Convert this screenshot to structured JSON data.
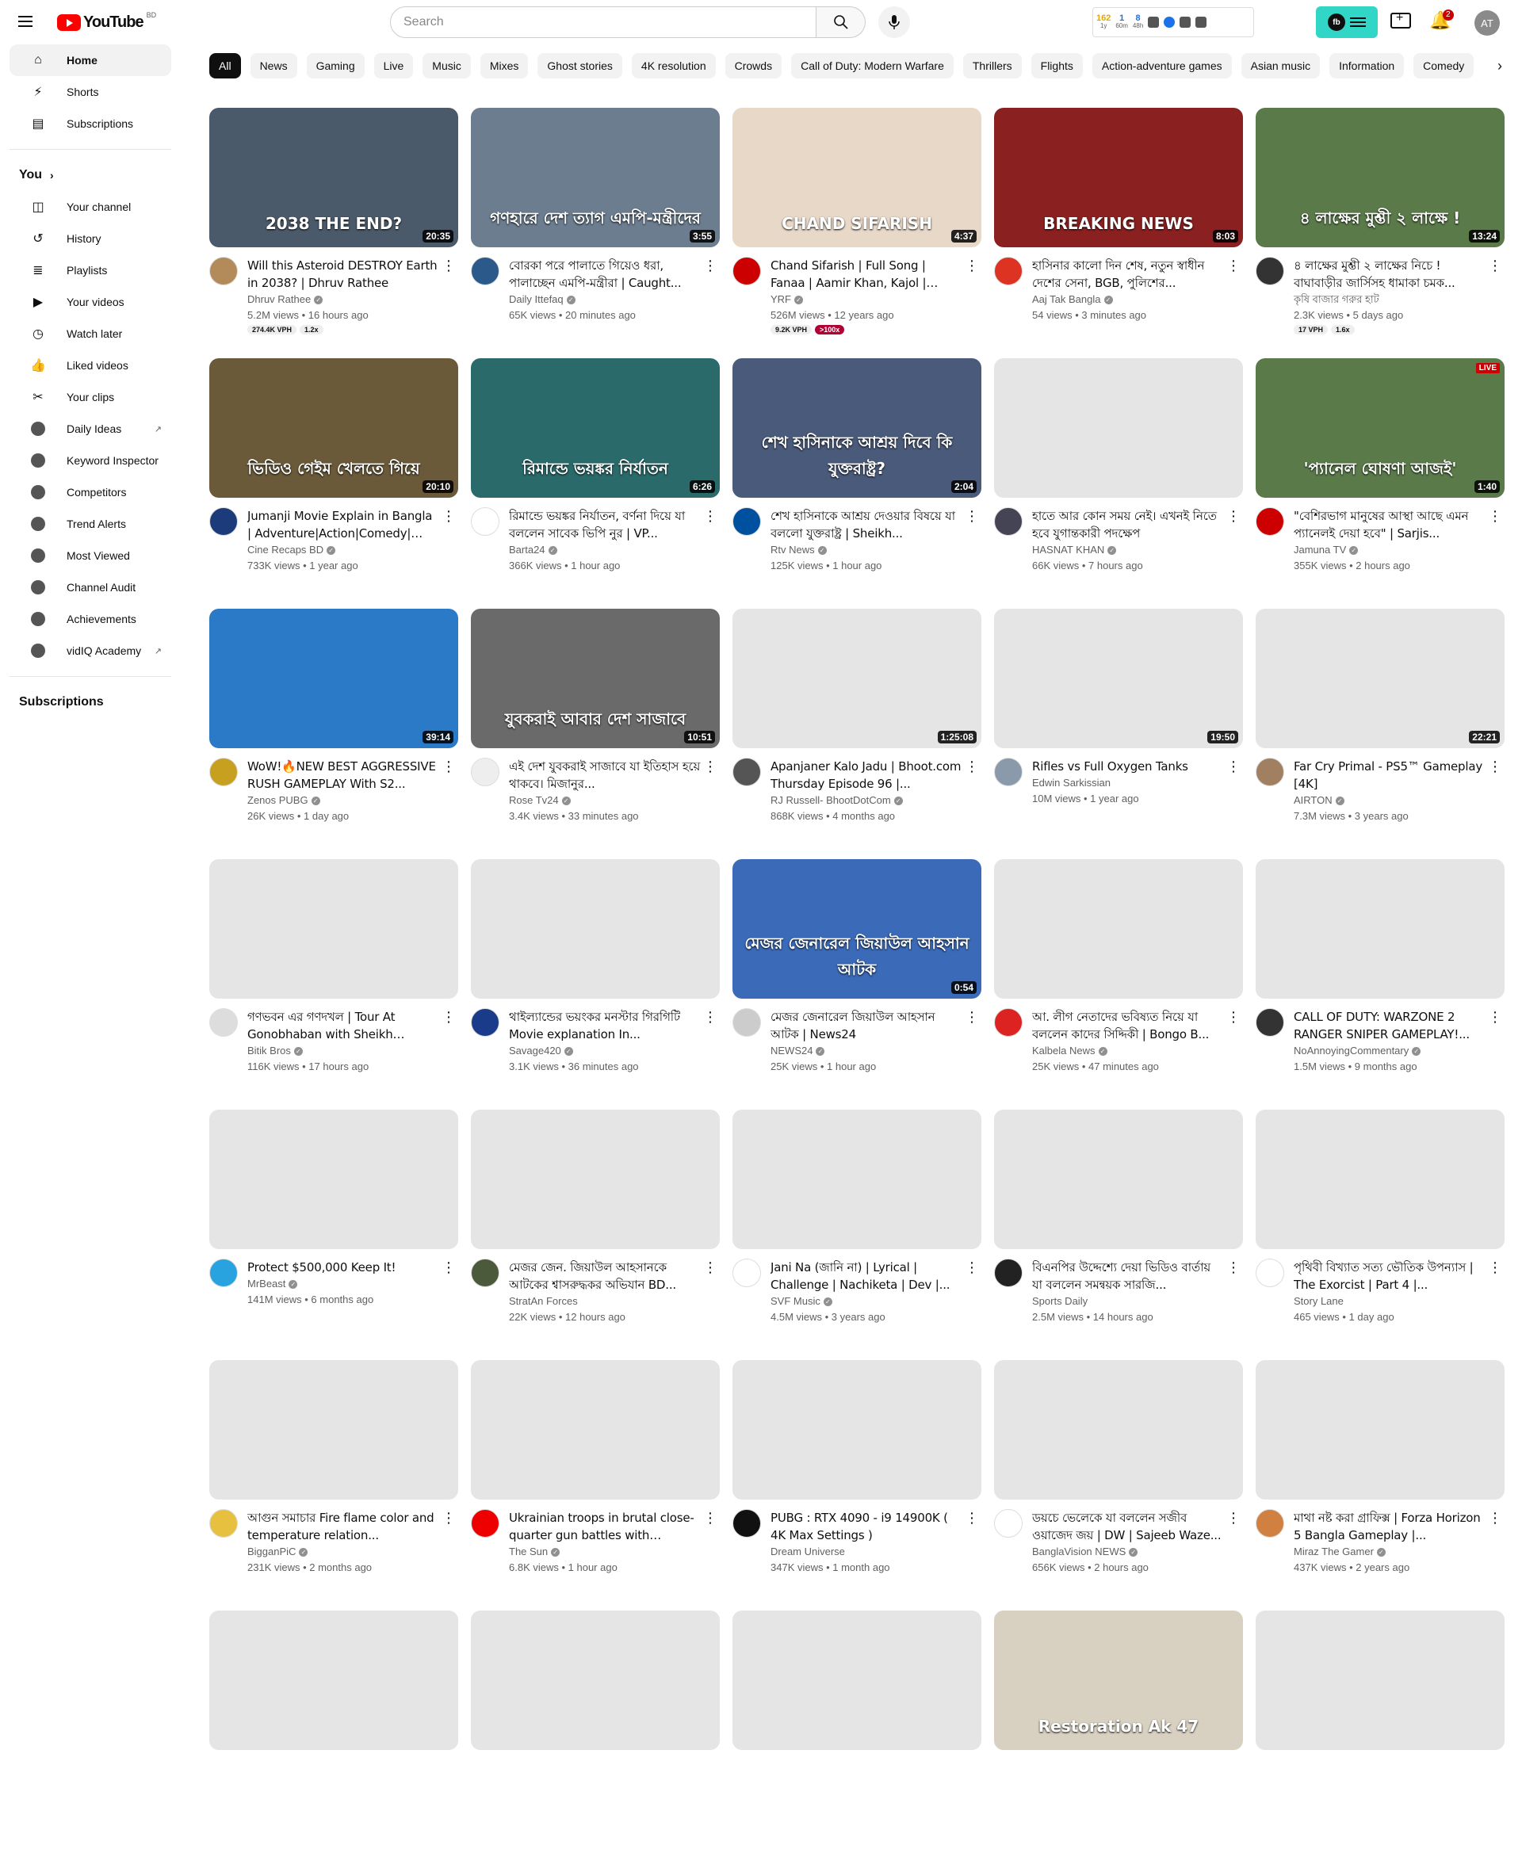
{
  "header": {
    "logo_text": "YouTube",
    "country": "BD",
    "search_placeholder": "Search",
    "avatar_initials": "AT",
    "notification_count": "2",
    "vidiq": {
      "stats": [
        {
          "value": "162",
          "label": "1y"
        },
        {
          "value": "1",
          "label": "60m"
        },
        {
          "value": "8",
          "label": "48h"
        }
      ],
      "badge": "fb"
    }
  },
  "sidebar": {
    "main": [
      {
        "label": "Home",
        "icon": "home-icon",
        "glyph": "⌂"
      },
      {
        "label": "Shorts",
        "icon": "shorts-icon",
        "glyph": "⚡"
      },
      {
        "label": "Subscriptions",
        "icon": "subscriptions-icon",
        "glyph": "▤"
      }
    ],
    "you_heading": "You",
    "you_items": [
      {
        "label": "Your channel",
        "icon": "channel-icon",
        "glyph": "◫"
      },
      {
        "label": "History",
        "icon": "history-icon",
        "glyph": "↺"
      },
      {
        "label": "Playlists",
        "icon": "playlists-icon",
        "glyph": "≣"
      },
      {
        "label": "Your videos",
        "icon": "your-videos-icon",
        "glyph": "▶"
      },
      {
        "label": "Watch later",
        "icon": "watch-later-icon",
        "glyph": "◷"
      },
      {
        "label": "Liked videos",
        "icon": "like-icon",
        "glyph": "👍"
      },
      {
        "label": "Your clips",
        "icon": "clips-icon",
        "glyph": "✂"
      }
    ],
    "vidiq_items": [
      {
        "label": "Daily Ideas",
        "external": true
      },
      {
        "label": "Keyword Inspector",
        "external": false
      },
      {
        "label": "Competitors",
        "external": false
      },
      {
        "label": "Trend Alerts",
        "external": false
      },
      {
        "label": "Most Viewed",
        "external": false
      },
      {
        "label": "Channel Audit",
        "external": false
      },
      {
        "label": "Achievements",
        "external": false
      },
      {
        "label": "vidIQ Academy",
        "external": true
      }
    ],
    "subscriptions_heading": "Subscriptions"
  },
  "chips": [
    "All",
    "News",
    "Gaming",
    "Live",
    "Music",
    "Mixes",
    "Ghost stories",
    "4K resolution",
    "Crowds",
    "Call of Duty: Modern Warfare",
    "Thrillers",
    "Flights",
    "Action-adventure games",
    "Asian music",
    "Information",
    "Comedy"
  ],
  "colors": {
    "accent": "#ff0000",
    "vidiq": "#31d6c6",
    "badge_red": "#b00034"
  },
  "videos": [
    {
      "title": "Will this Asteroid DESTROY Earth in 2038? | Dhruv Rathee",
      "channel": "Dhruv Rathee",
      "verified": true,
      "stats": "5.2M views • 16 hours ago",
      "duration": "20:35",
      "badges": [
        "274.4K VPH",
        "1.2x"
      ],
      "thumb_text": "2038  THE END?",
      "thumb_bg": "#4a5a6a",
      "av": "#b38a5a"
    },
    {
      "title": "বোরকা পরে পালাতে গিয়েও ধরা, পালাচ্ছেন এমপি-মন্ত্রীরা | Caught...",
      "channel": "Daily Ittefaq",
      "verified": true,
      "stats": "65K views • 20 minutes ago",
      "duration": "3:55",
      "badges": [],
      "thumb_text": "গণহারে দেশ ত্যাগ এমপি-মন্ত্রীদের",
      "thumb_bg": "#6b7d8f",
      "av": "#2b5a8a"
    },
    {
      "title": "Chand Sifarish | Full Song | Fanaa | Aamir Khan, Kajol | Shaan,...",
      "channel": "YRF",
      "verified": true,
      "stats": "526M views • 12 years ago",
      "duration": "4:37",
      "badges": [
        "9.2K VPH",
        ">100x"
      ],
      "thumb_text": "CHAND SIFARISH",
      "thumb_bg": "#e8d8c8",
      "av": "#c00"
    },
    {
      "title": "হাসিনার কালো দিন শেষ, নতুন স্বাধীন দেশের সেনা, BGB, পুলিশের...",
      "channel": "Aaj Tak Bangla",
      "verified": true,
      "stats": "54 views • 3 minutes ago",
      "duration": "8:03",
      "badges": [],
      "thumb_text": "BREAKING NEWS",
      "thumb_bg": "#8a2020",
      "av": "#d32"
    },
    {
      "title": "৪ লাক্ষের মুশ্তী ২ লাক্ষের নিচে ! বাঘাবাড়ীর জার্সিসহ ধামাকা চমক...",
      "channel": "কৃষি বাজার গরুর হাট",
      "verified": false,
      "stats": "2.3K views • 5 days ago",
      "duration": "13:24",
      "badges": [
        "17 VPH",
        "1.6x"
      ],
      "thumb_text": "৪ লাক্ষের মুশ্তী ২ লাক্ষে !",
      "thumb_bg": "#5a7a4a",
      "av": "#333"
    },
    {
      "title": "Jumanji Movie Explain in Bangla | Adventure|Action|Comedy| Cine...",
      "channel": "Cine Recaps BD",
      "verified": true,
      "stats": "733K views • 1 year ago",
      "duration": "20:10",
      "badges": [],
      "thumb_text": "ভিডিও গেইম খেলতে গিয়ে",
      "thumb_bg": "#6a5a3a",
      "av": "#1b3b7b"
    },
    {
      "title": "রিমান্ডে ভয়ঙ্কর নির্যাতন, বর্ণনা দিয়ে যা বললেন সাবেক ভিপি নুর | VP...",
      "channel": "Barta24",
      "verified": true,
      "stats": "366K views • 1 hour ago",
      "duration": "6:26",
      "badges": [],
      "thumb_text": "রিমান্ডে ভয়ঙ্কর নির্যাতন",
      "thumb_bg": "#2a6a6a",
      "av": "#fff"
    },
    {
      "title": "শেখ হাসিনাকে আশ্রয় দেওয়ার বিষয়ে যা বললো যুক্তরাষ্ট্র | Sheikh...",
      "channel": "Rtv News",
      "verified": true,
      "stats": "125K views • 1 hour ago",
      "duration": "2:04",
      "badges": [],
      "thumb_text": "শেখ হাসিনাকে আশ্রয় দিবে কি যুক্তরাষ্ট্র?",
      "thumb_bg": "#4a5a7a",
      "av": "#0050a0"
    },
    {
      "title": "হাতে আর কোন সময় নেই। এখনই নিতে হবে যুগান্তকারী পদক্ষেপ",
      "channel": "HASNAT KHAN",
      "verified": true,
      "stats": "66K views • 7 hours ago",
      "duration": "",
      "badges": [],
      "thumb_text": "",
      "thumb_bg": "#e5e5e5",
      "av": "#445"
    },
    {
      "title": "\"বেশিরভাগ মানুষের আস্থা আছে এমন প্যানেলই দেয়া হবে\" | Sarjis...",
      "channel": "Jamuna TV",
      "verified": true,
      "stats": "355K views • 2 hours ago",
      "duration": "1:40",
      "badges": [],
      "thumb_text": "'প্যানেল ঘোষণা আজই'",
      "thumb_bg": "#5a7a4a",
      "av": "#c00",
      "live": "LIVE"
    },
    {
      "title": "WoW!🔥NEW BEST AGGRESSIVE RUSH GAMEPLAY With S2...",
      "channel": "Zenos PUBG",
      "verified": true,
      "stats": "26K views • 1 day ago",
      "duration": "39:14",
      "badges": [],
      "thumb_text": "",
      "thumb_bg": "#2a7ac8",
      "av": "#c8a020"
    },
    {
      "title": "এই দেশ যুবকরাই সাজাবে যা ইতিহাস হয়ে থাকবে। মিজানুর...",
      "channel": "Rose Tv24",
      "verified": true,
      "stats": "3.4K views • 33 minutes ago",
      "duration": "10:51",
      "badges": [],
      "thumb_text": "যুবকরাই আবার দেশ সাজাবে",
      "thumb_bg": "#6a6a6a",
      "av": "#eee"
    },
    {
      "title": "Apanjaner Kalo Jadu | Bhoot.com Thursday Episode 96 |...",
      "channel": "RJ Russell- BhootDotCom",
      "verified": true,
      "stats": "868K views • 4 months ago",
      "duration": "1:25:08",
      "badges": [],
      "thumb_text": "",
      "thumb_bg": "#e5e5e5",
      "av": "#555"
    },
    {
      "title": "Rifles vs Full Oxygen Tanks",
      "channel": "Edwin Sarkissian",
      "verified": false,
      "stats": "10M views • 1 year ago",
      "duration": "19:50",
      "badges": [],
      "thumb_text": "",
      "thumb_bg": "#e5e5e5",
      "av": "#8a9aaa"
    },
    {
      "title": "Far Cry Primal - PS5™ Gameplay [4K]",
      "channel": "AIRTON",
      "verified": true,
      "stats": "7.3M views • 3 years ago",
      "duration": "22:21",
      "badges": [],
      "thumb_text": "",
      "thumb_bg": "#e5e5e5",
      "av": "#a08060"
    },
    {
      "title": "গণভবন এর গণদখল | Tour At Gonobhaban with Sheikh Hasin...",
      "channel": "Bitik Bros",
      "verified": true,
      "stats": "116K views • 17 hours ago",
      "duration": "",
      "badges": [],
      "thumb_text": "",
      "thumb_bg": "#e5e5e5",
      "av": "#ddd"
    },
    {
      "title": "থাইল্যান্ডের ভয়ংকর মনস্টার গিরগিটি Movie explanation In...",
      "channel": "Savage420",
      "verified": true,
      "stats": "3.1K views • 36 minutes ago",
      "duration": "",
      "badges": [],
      "thumb_text": "",
      "thumb_bg": "#e5e5e5",
      "av": "#1a3a8a"
    },
    {
      "title": "মেজর জেনারেল জিয়াউল আহসান আটক | News24",
      "channel": "NEWS24",
      "verified": true,
      "stats": "25K views • 1 hour ago",
      "duration": "0:54",
      "badges": [],
      "thumb_text": "মেজর জেনারেল জিয়াউল আহসান আটক",
      "thumb_bg": "#3a6ab8",
      "av": "#ccc"
    },
    {
      "title": "আ. লীগ নেতাদের ভবিষ্যত নিয়ে যা বললেন কাদের সিদ্দিকী | Bongo B...",
      "channel": "Kalbela News",
      "verified": true,
      "stats": "25K views • 47 minutes ago",
      "duration": "",
      "badges": [],
      "thumb_text": "",
      "thumb_bg": "#e5e5e5",
      "av": "#d22"
    },
    {
      "title": "CALL OF DUTY: WARZONE 2 RANGER SNIPER GAMEPLAY!...",
      "channel": "NoAnnoyingCommentary",
      "verified": true,
      "stats": "1.5M views • 9 months ago",
      "duration": "",
      "badges": [],
      "thumb_text": "",
      "thumb_bg": "#e5e5e5",
      "av": "#333"
    },
    {
      "title": "Protect $500,000 Keep It!",
      "channel": "MrBeast",
      "verified": true,
      "stats": "141M views • 6 months ago",
      "duration": "",
      "badges": [],
      "thumb_text": "",
      "thumb_bg": "#e5e5e5",
      "av": "#29a3e0"
    },
    {
      "title": "মেজর জেন. জিয়াউল আহসানকে আটকের শ্বাসরুদ্ধকর অভিযান BD...",
      "channel": "StratAn Forces",
      "verified": false,
      "stats": "22K views • 12 hours ago",
      "duration": "",
      "badges": [],
      "thumb_text": "",
      "thumb_bg": "#e5e5e5",
      "av": "#4a5a3a"
    },
    {
      "title": "Jani Na (জানি না) | Lyrical | Challenge | Nachiketa | Dev |...",
      "channel": "SVF Music",
      "verified": true,
      "stats": "4.5M views • 3 years ago",
      "duration": "",
      "badges": [],
      "thumb_text": "",
      "thumb_bg": "#e5e5e5",
      "av": "#fff"
    },
    {
      "title": "বিএনপির উদ্দেশ্যে দেয়া ভিডিও বার্তায় যা বললেন সমন্বয়ক সারজি...",
      "channel": "Sports Daily",
      "verified": false,
      "stats": "2.5M views • 14 hours ago",
      "duration": "",
      "badges": [],
      "thumb_text": "",
      "thumb_bg": "#e5e5e5",
      "av": "#222"
    },
    {
      "title": "পৃথিবী বিখ্যাত সত্য ভৌতিক উপন্যাস | The Exorcist | Part 4 |...",
      "channel": "Story Lane",
      "verified": false,
      "stats": "465 views • 1 day ago",
      "duration": "",
      "badges": [],
      "thumb_text": "",
      "thumb_bg": "#e5e5e5",
      "av": "#fff"
    },
    {
      "title": "আগুন সমাচার Fire flame color and temperature relation...",
      "channel": "BigganPiC",
      "verified": true,
      "stats": "231K views • 2 months ago",
      "duration": "",
      "badges": [],
      "thumb_text": "",
      "thumb_bg": "#e5e5e5",
      "av": "#e8c040"
    },
    {
      "title": "Ukrainian troops in brutal close-quarter gun battles with Russia...",
      "channel": "The Sun",
      "verified": true,
      "stats": "6.8K views • 1 hour ago",
      "duration": "",
      "badges": [],
      "thumb_text": "",
      "thumb_bg": "#e5e5e5",
      "av": "#e00"
    },
    {
      "title": "PUBG : RTX 4090 - i9 14900K ( 4K Max Settings )",
      "channel": "Dream Universe",
      "verified": false,
      "stats": "347K views • 1 month ago",
      "duration": "",
      "badges": [],
      "thumb_text": "",
      "thumb_bg": "#e5e5e5",
      "av": "#111"
    },
    {
      "title": "ডয়চে ভেলেকে যা বললেন সজীব ওয়াজেদ জয় | DW | Sajeeb Waze...",
      "channel": "BanglaVision NEWS",
      "verified": true,
      "stats": "656K views • 2 hours ago",
      "duration": "",
      "badges": [],
      "thumb_text": "",
      "thumb_bg": "#e5e5e5",
      "av": "#fff"
    },
    {
      "title": "মাথা নষ্ট করা গ্রাফিক্স | Forza Horizon 5 Bangla Gameplay |...",
      "channel": "Miraz The Gamer",
      "verified": true,
      "stats": "437K views • 2 years ago",
      "duration": "",
      "badges": [],
      "thumb_text": "",
      "thumb_bg": "#e5e5e5",
      "av": "#d08040"
    },
    {
      "title": "",
      "channel": "",
      "verified": false,
      "stats": "",
      "duration": "",
      "badges": [],
      "thumb_text": "",
      "thumb_bg": "#e5e5e5",
      "av": "#fff"
    },
    {
      "title": "",
      "channel": "",
      "verified": false,
      "stats": "",
      "duration": "",
      "badges": [],
      "thumb_text": "",
      "thumb_bg": "#e5e5e5",
      "av": "#fff"
    },
    {
      "title": "",
      "channel": "",
      "verified": false,
      "stats": "",
      "duration": "",
      "badges": [],
      "thumb_text": "",
      "thumb_bg": "#e5e5e5",
      "av": "#fff"
    },
    {
      "title": "",
      "channel": "",
      "verified": false,
      "stats": "",
      "duration": "",
      "badges": [],
      "thumb_text": "Restoration Ak 47",
      "thumb_bg": "#d8d0c0",
      "av": "#fff"
    },
    {
      "title": "",
      "channel": "",
      "verified": false,
      "stats": "",
      "duration": "",
      "badges": [],
      "thumb_text": "",
      "thumb_bg": "#e5e5e5",
      "av": "#fff"
    }
  ]
}
